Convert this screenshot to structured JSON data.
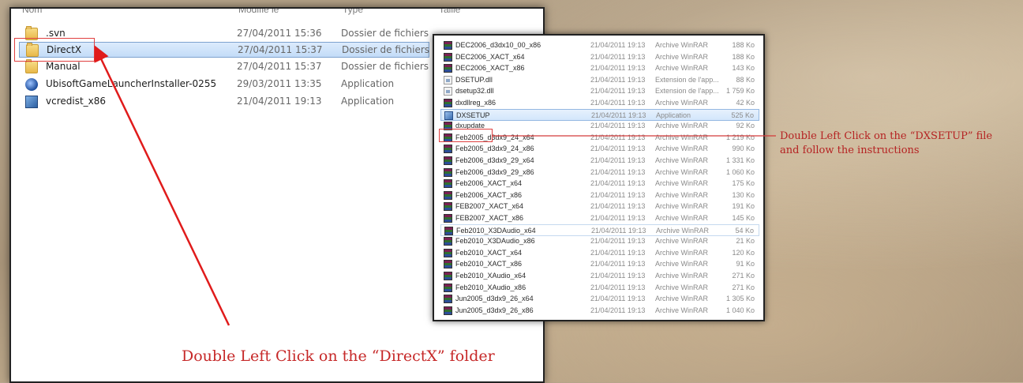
{
  "explorer": {
    "columns": [
      "Nom",
      "Modifié le",
      "Type",
      "Taille"
    ],
    "rows": [
      {
        "name": ".svn",
        "date": "27/04/2011 15:36",
        "type": "Dossier de fichiers",
        "icon": "folder-icon"
      },
      {
        "name": "DirectX",
        "date": "27/04/2011 15:37",
        "type": "Dossier de fichiers",
        "icon": "folder-icon"
      },
      {
        "name": "Manual",
        "date": "27/04/2011 15:37",
        "type": "Dossier de fichiers",
        "icon": "folder-icon"
      },
      {
        "name": "UbisoftGameLauncherInstaller-0255",
        "date": "29/03/2011 13:35",
        "type": "Application",
        "icon": "ubisoft-launcher-icon"
      },
      {
        "name": "vcredist_x86",
        "date": "21/04/2011 19:13",
        "type": "Application",
        "icon": "installer-icon"
      }
    ],
    "selected_index": 1
  },
  "directx_folder": {
    "rows": [
      {
        "name": "DEC2006_d3dx10_00_x86",
        "date": "21/04/2011 19:13",
        "type": "Archive WinRAR",
        "size": "188 Ko",
        "icon": "winrar-archive-icon"
      },
      {
        "name": "DEC2006_XACT_x64",
        "date": "21/04/2011 19:13",
        "type": "Archive WinRAR",
        "size": "188 Ko",
        "icon": "winrar-archive-icon"
      },
      {
        "name": "DEC2006_XACT_x86",
        "date": "21/04/2011 19:13",
        "type": "Archive WinRAR",
        "size": "143 Ko",
        "icon": "winrar-archive-icon"
      },
      {
        "name": "DSETUP.dll",
        "date": "21/04/2011 19:13",
        "type": "Extension de l'app...",
        "size": "88 Ko",
        "icon": "dll-file-icon"
      },
      {
        "name": "dsetup32.dll",
        "date": "21/04/2011 19:13",
        "type": "Extension de l'app...",
        "size": "1 759 Ko",
        "icon": "dll-file-icon"
      },
      {
        "name": "dxdllreg_x86",
        "date": "21/04/2011 19:13",
        "type": "Archive WinRAR",
        "size": "42 Ko",
        "icon": "winrar-archive-icon"
      },
      {
        "name": "DXSETUP",
        "date": "21/04/2011 19:13",
        "type": "Application",
        "size": "525 Ko",
        "icon": "application-icon"
      },
      {
        "name": "dxupdate",
        "date": "21/04/2011 19:13",
        "type": "Archive WinRAR",
        "size": "92 Ko",
        "icon": "winrar-archive-icon"
      },
      {
        "name": "Feb2005_d3dx9_24_x64",
        "date": "21/04/2011 19:13",
        "type": "Archive WinRAR",
        "size": "1 219 Ko",
        "icon": "winrar-archive-icon"
      },
      {
        "name": "Feb2005_d3dx9_24_x86",
        "date": "21/04/2011 19:13",
        "type": "Archive WinRAR",
        "size": "990 Ko",
        "icon": "winrar-archive-icon"
      },
      {
        "name": "Feb2006_d3dx9_29_x64",
        "date": "21/04/2011 19:13",
        "type": "Archive WinRAR",
        "size": "1 331 Ko",
        "icon": "winrar-archive-icon"
      },
      {
        "name": "Feb2006_d3dx9_29_x86",
        "date": "21/04/2011 19:13",
        "type": "Archive WinRAR",
        "size": "1 060 Ko",
        "icon": "winrar-archive-icon"
      },
      {
        "name": "Feb2006_XACT_x64",
        "date": "21/04/2011 19:13",
        "type": "Archive WinRAR",
        "size": "175 Ko",
        "icon": "winrar-archive-icon"
      },
      {
        "name": "Feb2006_XACT_x86",
        "date": "21/04/2011 19:13",
        "type": "Archive WinRAR",
        "size": "130 Ko",
        "icon": "winrar-archive-icon"
      },
      {
        "name": "FEB2007_XACT_x64",
        "date": "21/04/2011 19:13",
        "type": "Archive WinRAR",
        "size": "191 Ko",
        "icon": "winrar-archive-icon"
      },
      {
        "name": "FEB2007_XACT_x86",
        "date": "21/04/2011 19:13",
        "type": "Archive WinRAR",
        "size": "145 Ko",
        "icon": "winrar-archive-icon"
      },
      {
        "name": "Feb2010_X3DAudio_x64",
        "date": "21/04/2011 19:13",
        "type": "Archive WinRAR",
        "size": "54 Ko",
        "icon": "winrar-archive-icon"
      },
      {
        "name": "Feb2010_X3DAudio_x86",
        "date": "21/04/2011 19:13",
        "type": "Archive WinRAR",
        "size": "21 Ko",
        "icon": "winrar-archive-icon"
      },
      {
        "name": "Feb2010_XACT_x64",
        "date": "21/04/2011 19:13",
        "type": "Archive WinRAR",
        "size": "120 Ko",
        "icon": "winrar-archive-icon"
      },
      {
        "name": "Feb2010_XACT_x86",
        "date": "21/04/2011 19:13",
        "type": "Archive WinRAR",
        "size": "91 Ko",
        "icon": "winrar-archive-icon"
      },
      {
        "name": "Feb2010_XAudio_x64",
        "date": "21/04/2011 19:13",
        "type": "Archive WinRAR",
        "size": "271 Ko",
        "icon": "winrar-archive-icon"
      },
      {
        "name": "Feb2010_XAudio_x86",
        "date": "21/04/2011 19:13",
        "type": "Archive WinRAR",
        "size": "271 Ko",
        "icon": "winrar-archive-icon"
      },
      {
        "name": "Jun2005_d3dx9_26_x64",
        "date": "21/04/2011 19:13",
        "type": "Archive WinRAR",
        "size": "1 305 Ko",
        "icon": "winrar-archive-icon"
      },
      {
        "name": "Jun2005_d3dx9_26_x86",
        "date": "21/04/2011 19:13",
        "type": "Archive WinRAR",
        "size": "1 040 Ko",
        "icon": "winrar-archive-icon"
      }
    ],
    "highlighted_index": 6,
    "hover_index": 16
  },
  "annotations": {
    "directx_caption": "Double Left Click on the “DirectX” folder",
    "dxsetup_caption_line1": "Double Left Click on the “DXSETUP” file",
    "dxsetup_caption_line2": "and follow the instructions",
    "color": "#c62828"
  }
}
